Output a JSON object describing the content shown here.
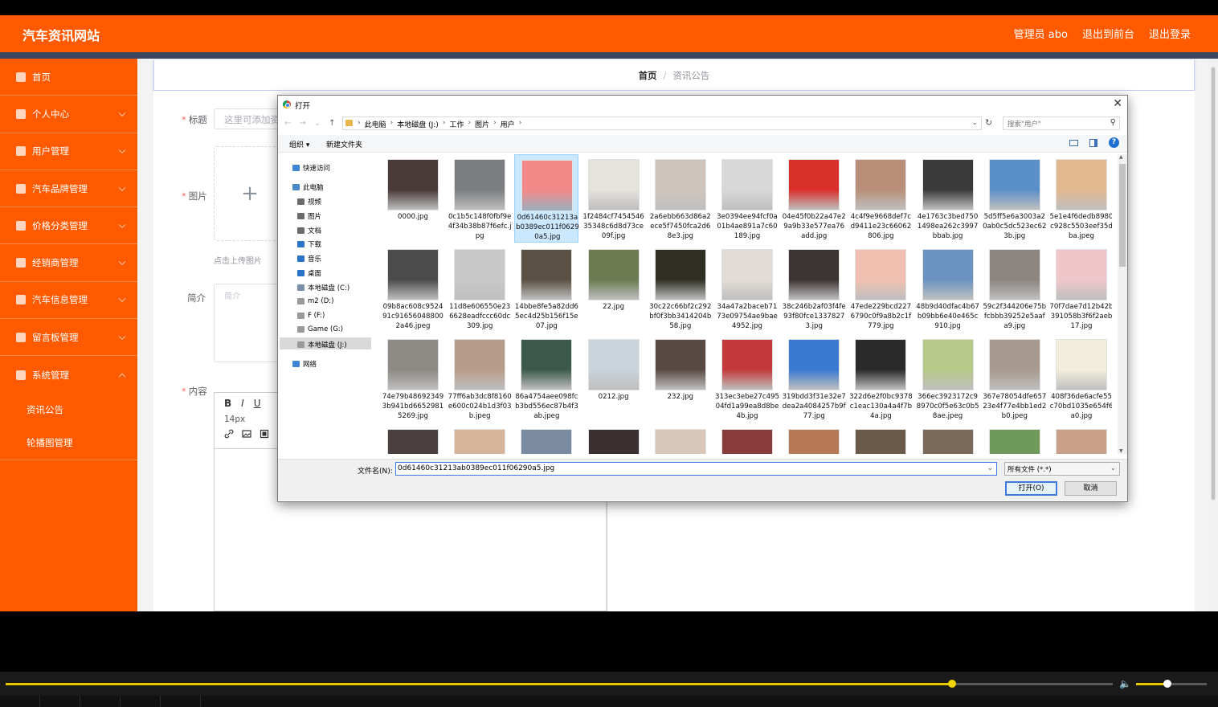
{
  "app": {
    "brand": "汽车资讯网站",
    "top_links": [
      "管理员 abo",
      "退出到前台",
      "退出登录"
    ],
    "sidebar": [
      {
        "label": "首页",
        "icon": "home-icon",
        "chevron": false
      },
      {
        "label": "个人中心",
        "icon": "person-icon",
        "chevron": true
      },
      {
        "label": "用户管理",
        "icon": "user-icon",
        "chevron": true
      },
      {
        "label": "汽车品牌管理",
        "icon": "list-icon",
        "chevron": true
      },
      {
        "label": "价格分类管理",
        "icon": "copy-icon",
        "chevron": true
      },
      {
        "label": "经销商管理",
        "icon": "grid-icon",
        "chevron": true
      },
      {
        "label": "汽车信息管理",
        "icon": "clock-icon",
        "chevron": true
      },
      {
        "label": "留言板管理",
        "icon": "user-icon",
        "chevron": true
      },
      {
        "label": "系统管理",
        "icon": "message-icon",
        "chevron": true,
        "expanded": true
      }
    ],
    "sub_items": [
      "资讯公告",
      "轮播图管理"
    ],
    "breadcrumb": {
      "home": "首页",
      "sep": "/",
      "current": "资讯公告"
    },
    "form": {
      "title_label": "标题",
      "title_placeholder": "这里可添加资",
      "image_label": "图片",
      "upload_plus": "+",
      "upload_hint": "点击上传图片",
      "brief_label": "简介",
      "brief_placeholder": "简介",
      "content_label": "内容",
      "editor_tools": [
        "B",
        "I",
        "U"
      ],
      "font_size": "14px"
    }
  },
  "dialog": {
    "title": "打开",
    "close": "✕",
    "path": [
      "此电脑",
      "本地磁盘 (J:)",
      "工作",
      "图片",
      "用户"
    ],
    "search_placeholder": "搜索\"用户\"",
    "organize": "组织 ▾",
    "new_folder": "新建文件夹",
    "tree": [
      {
        "label": "快速访问",
        "color": "#3f86d6",
        "indent": 0
      },
      {
        "label": "此电脑",
        "color": "#4c87c9",
        "indent": 0
      },
      {
        "label": "视频",
        "color": "#6b6b6b",
        "indent": 1
      },
      {
        "label": "图片",
        "color": "#6b6b6b",
        "indent": 1
      },
      {
        "label": "文档",
        "color": "#6b6b6b",
        "indent": 1
      },
      {
        "label": "下载",
        "color": "#2b73c9",
        "indent": 1
      },
      {
        "label": "音乐",
        "color": "#2b73c9",
        "indent": 1
      },
      {
        "label": "桌面",
        "color": "#2b73c9",
        "indent": 1
      },
      {
        "label": "本地磁盘 (C:)",
        "color": "#7a8ea8",
        "indent": 1
      },
      {
        "label": "m2 (D:)",
        "color": "#999999",
        "indent": 1
      },
      {
        "label": "F (F:)",
        "color": "#999999",
        "indent": 1
      },
      {
        "label": "Game (G:)",
        "color": "#999999",
        "indent": 1
      },
      {
        "label": "本地磁盘 (J:)",
        "color": "#999999",
        "indent": 1,
        "selected": true
      },
      {
        "label": "网络",
        "color": "#3f86d6",
        "indent": 0
      }
    ],
    "files": [
      {
        "name": "0000.jpg",
        "color": "#4a3a3a"
      },
      {
        "name": "0c1b5c148f0fbf9e4f34b38b87f6efc.jpg",
        "color": "#7b7d80"
      },
      {
        "name": "0d61460c31213ab0389ec011f06290a5.jpg",
        "color": "#f28a8a",
        "selected": true
      },
      {
        "name": "1f2484cf745454635348c6d8d73ce09f.jpg",
        "color": "#e6e2de"
      },
      {
        "name": "2a6ebb663d86a2ece5f7450fca2d68e3.jpg",
        "color": "#cfc4bb"
      },
      {
        "name": "3e0394ee94fcf0a01b4ae891a7c60189.jpg",
        "color": "#d8d8d8"
      },
      {
        "name": "04e45f0b22a47e29a9b33e577ea76add.jpg",
        "color": "#d9302b"
      },
      {
        "name": "4c4f9e9668def7cd9411e23c66062806.jpg",
        "color": "#b98f7a"
      },
      {
        "name": "4e1763c3bed7501498ea262c3997bbab.jpg",
        "color": "#3a3a3a"
      },
      {
        "name": "5d5ff5e6a3003a20ab0c5dc523ec623b.jpg",
        "color": "#5b8fc9"
      },
      {
        "name": "5e1e4f6dedb8980c928c5503eef35dba.jpeg",
        "color": "#e2b88f"
      },
      {
        "name": "09b8ac608c952491c916560488002a46.jpeg",
        "color": "#4b4b4b"
      },
      {
        "name": "11d8e606550e236628eadfccc60dc309.jpg",
        "color": "#c8c8c8"
      },
      {
        "name": "14bbe8fe5a82dd65ec4d25b156f15e07.jpg",
        "color": "#5b5044"
      },
      {
        "name": "22.jpg",
        "color": "#6c7b52"
      },
      {
        "name": "30c22c66bf2c292bf0f3bb3414204b58.jpg",
        "color": "#2e2e22"
      },
      {
        "name": "34a47a2baceb7173e09754ae9bae4952.jpg",
        "color": "#e3dcd6"
      },
      {
        "name": "38c246b2af03f4fe93f80fce13378273.jpg",
        "color": "#3c3432"
      },
      {
        "name": "47ede229bcd2276790c0f9a8b2c1f779.jpg",
        "color": "#f2c0b0"
      },
      {
        "name": "48b9d40dfac4b67b09bb6e40e465c910.jpg",
        "color": "#6a93c1"
      },
      {
        "name": "59c2f344206e75bfcbbb39252e5aafa9.jpg",
        "color": "#8c8580"
      },
      {
        "name": "70f7dae7d12b42b391058b3f6f2aeb17.jpg",
        "color": "#efc7cb"
      },
      {
        "name": "74e79b486923493b941bd66529815269.jpg",
        "color": "#8e8a86"
      },
      {
        "name": "77ff6ab3dc8f8160e600c024b1d3f03b.jpeg",
        "color": "#b89c8a"
      },
      {
        "name": "86a4754aee098fcb3bd556ec87b4f3ab.jpeg",
        "color": "#3c5a4c"
      },
      {
        "name": "0212.jpg",
        "color": "#c9d4dc"
      },
      {
        "name": "232.jpg",
        "color": "#5a4a44"
      },
      {
        "name": "313ec3ebe27c49504fd1a99ea8d8be4b.jpg",
        "color": "#c43a3a"
      },
      {
        "name": "319bdd3f31e32e7dea2a4084257b9f77.jpg",
        "color": "#3a7ad1"
      },
      {
        "name": "322d6e2f0bc9378c1eac130a4a4f7b4a.jpg",
        "color": "#2b2b2b"
      },
      {
        "name": "366ec3923172c98970c0f5e63c0b58ae.jpeg",
        "color": "#b9c98a"
      },
      {
        "name": "367e78054dfe65723e4f77e4bb1ed2b0.jpeg",
        "color": "#a8998e"
      },
      {
        "name": "408f36de6acfe55c70bd1035e654f6a0.jpg",
        "color": "#f2eedb"
      },
      {
        "name": "",
        "color": "#4a4040"
      },
      {
        "name": "",
        "color": "#d5b49a"
      },
      {
        "name": "",
        "color": "#7a8aa0"
      },
      {
        "name": "",
        "color": "#3a3030"
      },
      {
        "name": "",
        "color": "#d8c6b8"
      },
      {
        "name": "",
        "color": "#8a3a3a"
      },
      {
        "name": "",
        "color": "#b57a55"
      },
      {
        "name": "",
        "color": "#6a5a4a"
      },
      {
        "name": "",
        "color": "#7a6a5a"
      },
      {
        "name": "",
        "color": "#6f9a5a"
      },
      {
        "name": "",
        "color": "#c9a08a"
      }
    ],
    "filename_label": "文件名(N):",
    "filename_value": "0d61460c31213ab0389ec011f06290a5.jpg",
    "file_type": "所有文件 (*.*)",
    "open_button": "打开(O)",
    "cancel_button": "取消"
  },
  "player": {
    "progress": 0.855,
    "volume": 0.44
  }
}
